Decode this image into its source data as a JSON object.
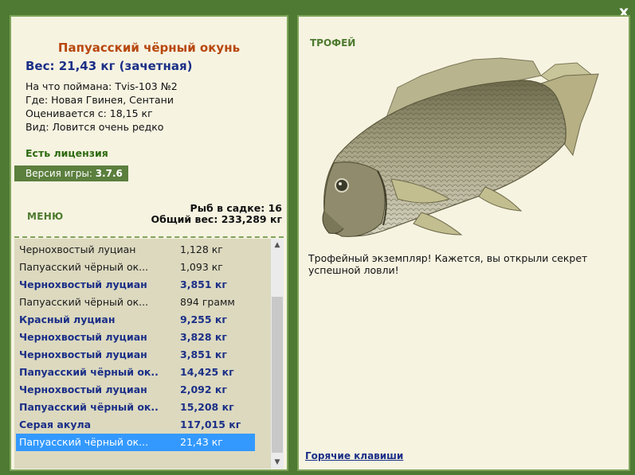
{
  "window": {
    "close_label": "x"
  },
  "fish": {
    "title": "Папуасский чёрный окунь",
    "weight": "Вес: 21,43 кг (зачетная)",
    "caught_with": "На что поймана: Tvis-103 №2",
    "location": "Где: Новая Гвинея, Сентани",
    "value_from": "Оценивается с: 18,15 кг",
    "species_note": "Вид: Ловится очень редко"
  },
  "license_text": "Есть лицензия",
  "version": {
    "label": "Версия игры: ",
    "number": "3.7.6"
  },
  "menu_label": "МЕНЮ",
  "stats": {
    "fish_count": "Рыб в садке: 16",
    "total_weight": "Общий вес: 233,289 кг"
  },
  "catch_list": [
    {
      "name": "Чернохвостый луциан",
      "weight": "1,128 кг",
      "style": "normal"
    },
    {
      "name": "Папуасский чёрный ок...",
      "weight": "1,093 кг",
      "style": "normal"
    },
    {
      "name": "Чернохвостый луциан",
      "weight": "3,851 кг",
      "style": "bold"
    },
    {
      "name": "Папуасский чёрный ок...",
      "weight": "894 грамм",
      "style": "normal"
    },
    {
      "name": "Красный луциан",
      "weight": "9,255 кг",
      "style": "bold"
    },
    {
      "name": "Чернохвостый луциан",
      "weight": "3,828 кг",
      "style": "bold"
    },
    {
      "name": "Чернохвостый луциан",
      "weight": "3,851 кг",
      "style": "bold"
    },
    {
      "name": "Папуасский чёрный ок...",
      "weight": "14,425 кг",
      "style": "bold"
    },
    {
      "name": "Чернохвостый луциан",
      "weight": "2,092 кг",
      "style": "bold"
    },
    {
      "name": "Папуасский чёрный ок...",
      "weight": "15,208 кг",
      "style": "bold"
    },
    {
      "name": "Серая акула",
      "weight": "117,015 кг",
      "style": "bold"
    },
    {
      "name": "Папуасский чёрный ок...",
      "weight": "21,43 кг",
      "style": "selected"
    }
  ],
  "trophy": {
    "badge": "ТРОФЕЙ",
    "description": "Трофейный экземпляр! Кажется, вы открыли секрет успешной ловли!"
  },
  "hotkeys_link": "Горячие клавиши",
  "icons": {
    "scroll_up": "scroll-up-arrow-icon",
    "scroll_down": "scroll-down-arrow-icon",
    "fish_image": "fish-illustration"
  },
  "colors": {
    "frame": "#4e7a33",
    "title": "#b8470d",
    "accent_blue": "#1b2f87",
    "green_text": "#2d6a10",
    "selection": "#3399ff"
  }
}
